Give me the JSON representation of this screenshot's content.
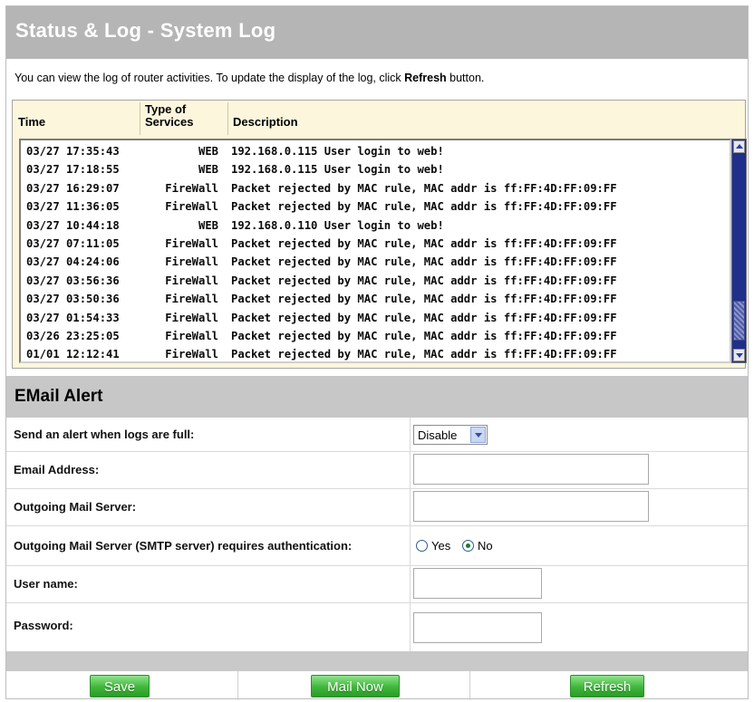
{
  "header": {
    "title": "Status & Log - System Log"
  },
  "intro": {
    "text_before": "You can view the log of router activities. To update the display of the log, click ",
    "bold": "Refresh",
    "text_after": " button."
  },
  "log": {
    "columns": {
      "time": "Time",
      "type_line1": "Type of",
      "type_line2": "Services",
      "description": "Description"
    },
    "rows": [
      {
        "time": "03/27 17:35:43",
        "service": "WEB",
        "description": "192.168.0.115 User login to web!"
      },
      {
        "time": "03/27 17:18:55",
        "service": "WEB",
        "description": "192.168.0.115 User login to web!"
      },
      {
        "time": "03/27 16:29:07",
        "service": "FireWall",
        "description": "Packet rejected by MAC rule, MAC addr is ff:FF:4D:FF:09:FF"
      },
      {
        "time": "03/27 11:36:05",
        "service": "FireWall",
        "description": "Packet rejected by MAC rule, MAC addr is ff:FF:4D:FF:09:FF"
      },
      {
        "time": "03/27 10:44:18",
        "service": "WEB",
        "description": "192.168.0.110 User login to web!"
      },
      {
        "time": "03/27 07:11:05",
        "service": "FireWall",
        "description": "Packet rejected by MAC rule, MAC addr is ff:FF:4D:FF:09:FF"
      },
      {
        "time": "03/27 04:24:06",
        "service": "FireWall",
        "description": "Packet rejected by MAC rule, MAC addr is ff:FF:4D:FF:09:FF"
      },
      {
        "time": "03/27 03:56:36",
        "service": "FireWall",
        "description": "Packet rejected by MAC rule, MAC addr is ff:FF:4D:FF:09:FF"
      },
      {
        "time": "03/27 03:50:36",
        "service": "FireWall",
        "description": "Packet rejected by MAC rule, MAC addr is ff:FF:4D:FF:09:FF"
      },
      {
        "time": "03/27 01:54:33",
        "service": "FireWall",
        "description": "Packet rejected by MAC rule, MAC addr is ff:FF:4D:FF:09:FF"
      },
      {
        "time": "03/26 23:25:05",
        "service": "FireWall",
        "description": "Packet rejected by MAC rule, MAC addr is ff:FF:4D:FF:09:FF"
      },
      {
        "time": "01/01 12:12:41",
        "service": "FireWall",
        "description": "Packet rejected by MAC rule, MAC addr is ff:FF:4D:FF:09:FF"
      }
    ]
  },
  "email_alert": {
    "title": "EMail Alert",
    "send_alert": {
      "label": "Send an alert when logs are full:",
      "selected": "Disable"
    },
    "email_address": {
      "label": "Email Address:",
      "value": ""
    },
    "mail_server": {
      "label": "Outgoing Mail Server:",
      "value": ""
    },
    "auth": {
      "label": "Outgoing Mail Server (SMTP server) requires authentication:",
      "yes": "Yes",
      "no": "No",
      "selected": "No"
    },
    "username": {
      "label": "User name:",
      "value": ""
    },
    "password": {
      "label": "Password:",
      "value": ""
    }
  },
  "buttons": {
    "save": "Save",
    "mail_now": "Mail Now",
    "refresh": "Refresh"
  },
  "colors": {
    "header_bg": "#b5b5b5",
    "log_panel_bg": "#fcf6dc",
    "scrollbar": "#1f2f8a",
    "button_green": "#3fb63b"
  }
}
